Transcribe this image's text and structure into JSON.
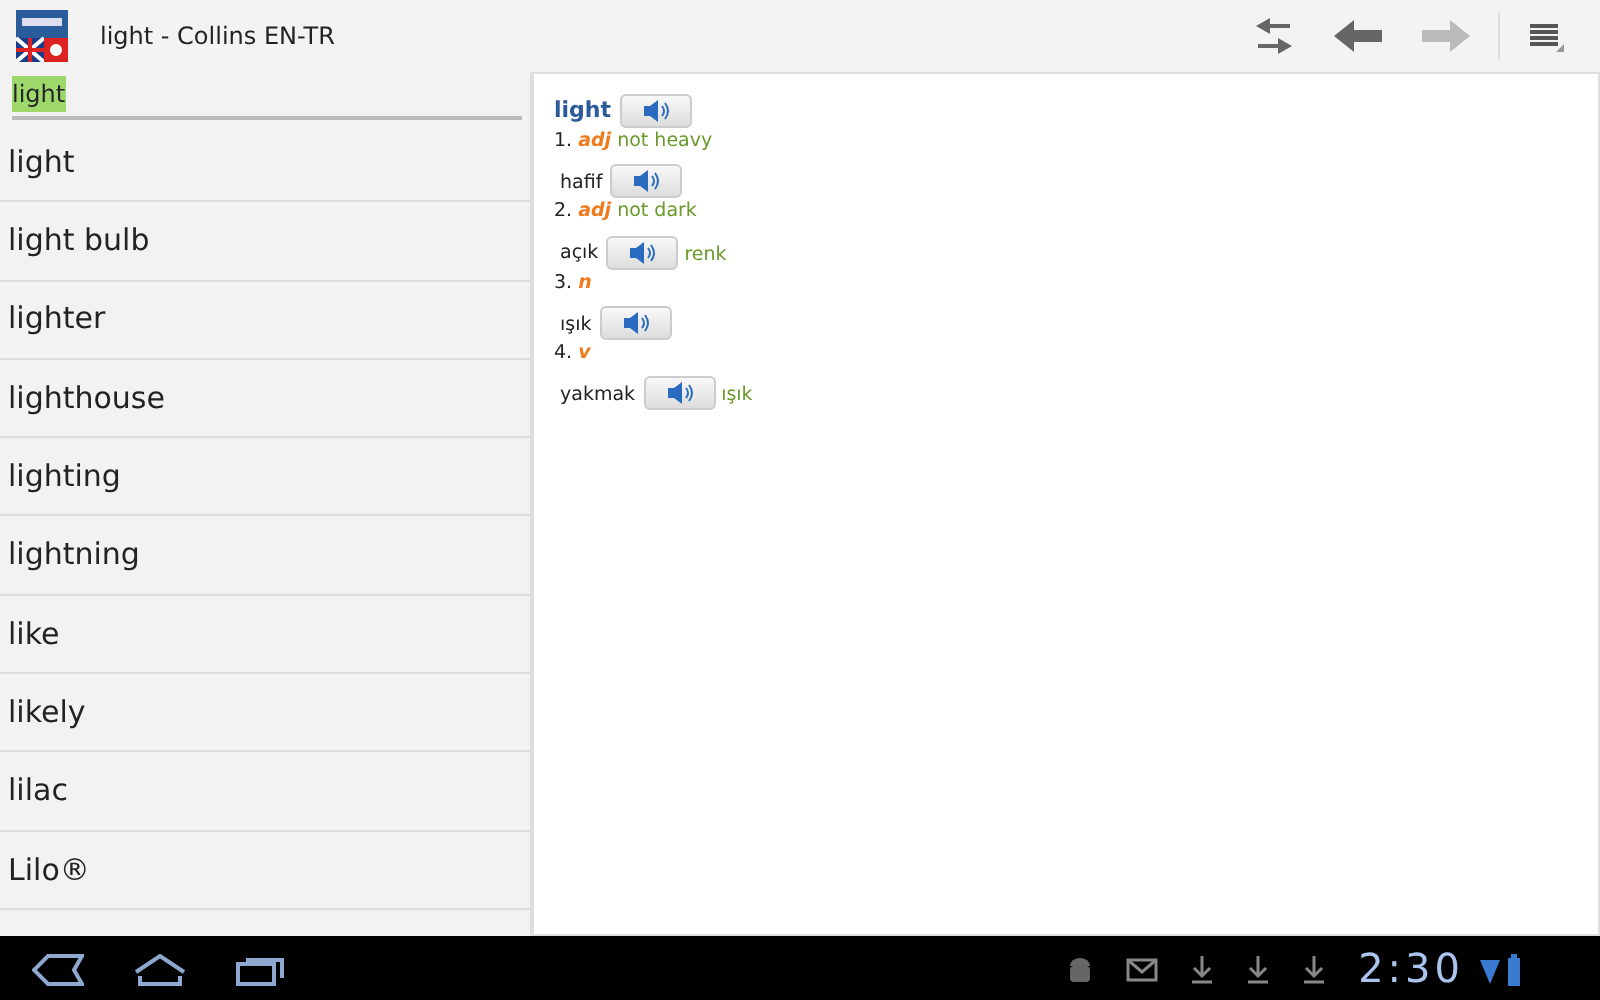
{
  "app_bar": {
    "title": "light - Collins EN-TR",
    "back_disabled": false,
    "forward_disabled": true
  },
  "search": {
    "value": "light"
  },
  "word_list": [
    "light",
    "light bulb",
    "lighter",
    "lighthouse",
    "lighting",
    "lightning",
    "like",
    "likely",
    "lilac",
    "Lilo®"
  ],
  "entry": {
    "headword": "light",
    "senses": [
      {
        "number": "1.",
        "pos": "adj",
        "gloss": "not heavy",
        "translation": "hafif"
      },
      {
        "number": "2.",
        "pos": "adj",
        "gloss": "not dark",
        "translation": "açık",
        "note": "renk"
      },
      {
        "number": "3.",
        "pos": "n",
        "translation": "ışık"
      },
      {
        "number": "4.",
        "pos": "v",
        "translation": "yakmak",
        "note": "ışık"
      }
    ]
  },
  "status_bar": {
    "time": "2:30"
  }
}
